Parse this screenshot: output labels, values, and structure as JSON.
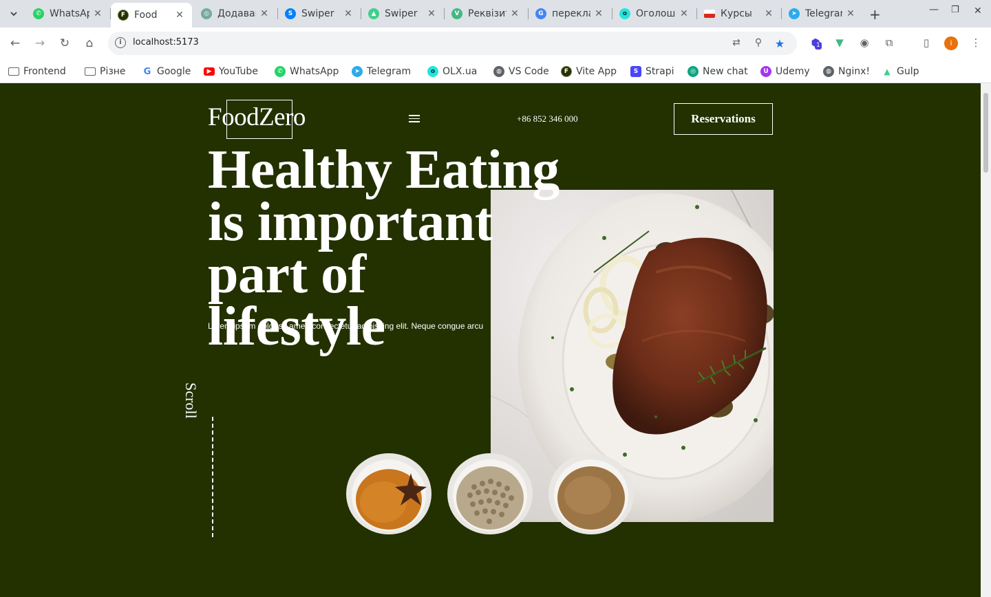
{
  "browser": {
    "tabs": [
      {
        "title": "WhatsApp",
        "favicon": "whatsapp-icon",
        "color": "#25d366"
      },
      {
        "title": "Food",
        "favicon": "food-icon",
        "color": "#233000",
        "active": true
      },
      {
        "title": "Додавання",
        "favicon": "chatgpt-icon",
        "color": "#5f6368"
      },
      {
        "title": "Swiper",
        "favicon": "swiper-icon",
        "color": "#0080ff"
      },
      {
        "title": "Swiper",
        "favicon": "vite-icon",
        "color": "#3ecf8e"
      },
      {
        "title": "Реквізити",
        "favicon": "vue-icon",
        "color": "#42b883"
      },
      {
        "title": "переклад",
        "favicon": "google-icon",
        "color": "#4285f4"
      },
      {
        "title": "Оголошення",
        "favicon": "olx-icon",
        "color": "#23e5db"
      },
      {
        "title": "Курсы",
        "favicon": "flag-icon",
        "color": "#d52b1e"
      },
      {
        "title": "Telegram",
        "favicon": "telegram-icon",
        "color": "#2aabee"
      }
    ],
    "url": "localhost:5173",
    "profile_initial": "i",
    "extension_badge": "1",
    "bookmarks": [
      {
        "label": "Frontend",
        "icon": "folder-icon"
      },
      {
        "label": "Різне",
        "icon": "folder-icon"
      },
      {
        "label": "Google",
        "icon": "google-icon",
        "color": "#4285f4"
      },
      {
        "label": "YouTube",
        "icon": "youtube-icon",
        "color": "#ff0000"
      },
      {
        "label": "WhatsApp",
        "icon": "whatsapp-icon",
        "color": "#25d366"
      },
      {
        "label": "Telegram",
        "icon": "telegram-icon",
        "color": "#2aabee"
      },
      {
        "label": "OLX.ua",
        "icon": "olx-icon",
        "color": "#23e5db"
      },
      {
        "label": "VS Code",
        "icon": "globe-icon",
        "color": "#5f6368"
      },
      {
        "label": "Vite App",
        "icon": "food-icon",
        "color": "#233000"
      },
      {
        "label": "Strapi",
        "icon": "strapi-icon",
        "color": "#4945ff"
      },
      {
        "label": "New chat",
        "icon": "chatgpt-icon",
        "color": "#10a37f"
      },
      {
        "label": "Udemy",
        "icon": "udemy-icon",
        "color": "#a435f0"
      },
      {
        "label": "Nginx!",
        "icon": "globe-icon",
        "color": "#5f6368"
      },
      {
        "label": "Gulp",
        "icon": "vite-icon",
        "color": "#3ecf8e"
      }
    ]
  },
  "page": {
    "background": "#233000",
    "logo": "FoodZero",
    "phone": "+86 852 346 000",
    "reservations_label": "Reservations",
    "headline": [
      "Healthy Eating",
      "is important",
      "part of",
      "lifestyle"
    ],
    "lorem": "Lorem ipsum dolor sit amet, consectetur adipiscing elit. Neque congue arcu",
    "scroll_label": "Scroll",
    "spices": [
      "spice-bowl-cinnamon",
      "spice-bowl-pepper",
      "spice-bowl-ground"
    ]
  }
}
